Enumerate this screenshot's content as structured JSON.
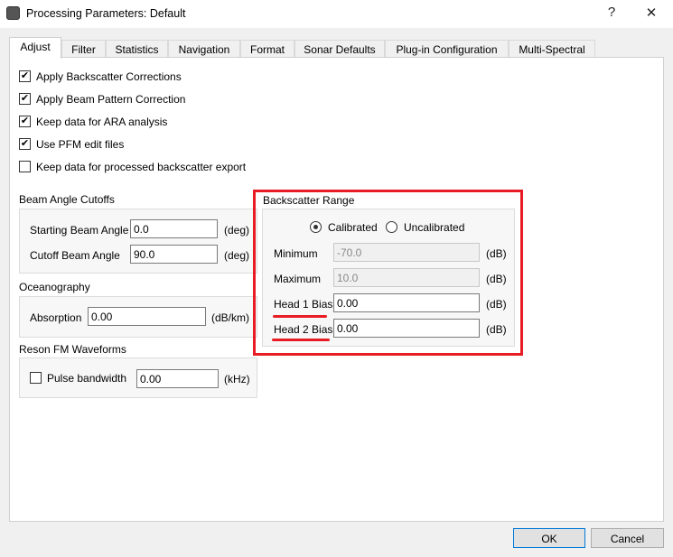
{
  "window": {
    "title": "Processing Parameters: Default",
    "help": "?",
    "close": "✕"
  },
  "tabs": [
    "Adjust",
    "Filter",
    "Statistics",
    "Navigation",
    "Format",
    "Sonar Defaults",
    "Plug-in Configuration",
    "Multi-Spectral"
  ],
  "checkboxes": [
    {
      "label": "Apply Backscatter Corrections",
      "checked": true
    },
    {
      "label": "Apply Beam Pattern Correction",
      "checked": true
    },
    {
      "label": "Keep data for ARA analysis",
      "checked": true
    },
    {
      "label": "Use PFM edit files",
      "checked": true
    },
    {
      "label": "Keep data for processed backscatter export",
      "checked": false
    }
  ],
  "beam": {
    "title": "Beam Angle Cutoffs",
    "start_label": "Starting Beam Angle",
    "start_value": "0.0",
    "cutoff_label": "Cutoff Beam Angle",
    "cutoff_value": "90.0",
    "unit": "(deg)"
  },
  "ocean": {
    "title": "Oceanography",
    "absorption_label": "Absorption",
    "absorption_value": "0.00",
    "unit": "(dB/km)"
  },
  "reson": {
    "title": "Reson FM Waveforms",
    "pulse_label": "Pulse bandwidth",
    "pulse_checked": false,
    "pulse_value": "0.00",
    "unit": "(kHz)"
  },
  "backscatter": {
    "title": "Backscatter Range",
    "calibrated": "Calibrated",
    "uncalibrated": "Uncalibrated",
    "selected": "Calibrated",
    "rows": [
      {
        "label": "Minimum",
        "value": "-70.0",
        "unit": "(dB)"
      },
      {
        "label": "Maximum",
        "value": "10.0",
        "unit": "(dB)"
      },
      {
        "label": "Head 1 Bias",
        "value": "0.00",
        "unit": "(dB)"
      },
      {
        "label": "Head 2 Bias",
        "value": "0.00",
        "unit": "(dB)"
      }
    ]
  },
  "buttons": {
    "ok": "OK",
    "cancel": "Cancel"
  },
  "colors": {
    "highlight": "#e81c24"
  }
}
